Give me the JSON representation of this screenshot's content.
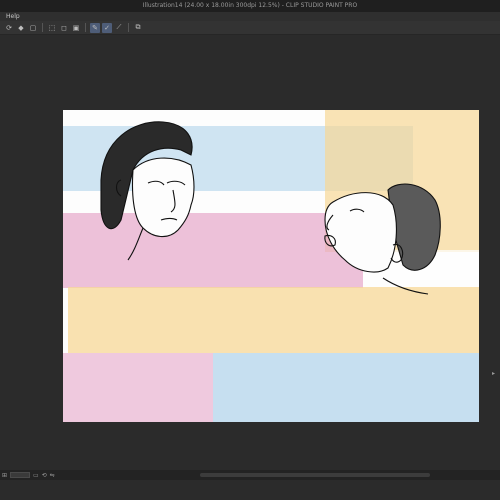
{
  "window": {
    "title": "Illustration14 (24.00 x 18.00in 300dpi 12.5%)  - CLIP STUDIO PAINT PRO"
  },
  "menu": {
    "help_label": "Help"
  },
  "toolbar": {
    "icons": [
      "undo-rotate-icon",
      "fill-bucket-icon",
      "clear-layer-icon",
      "selection-icon",
      "pen-icon",
      "snap-ruler-icon",
      "transform-icon"
    ]
  },
  "canvas": {
    "background": "#fdfdfd"
  },
  "colors": {
    "pink": "#e6a6c9",
    "yellow": "#f7d796",
    "blue": "#a9cfe9",
    "workspace": "#2b2b2b"
  }
}
